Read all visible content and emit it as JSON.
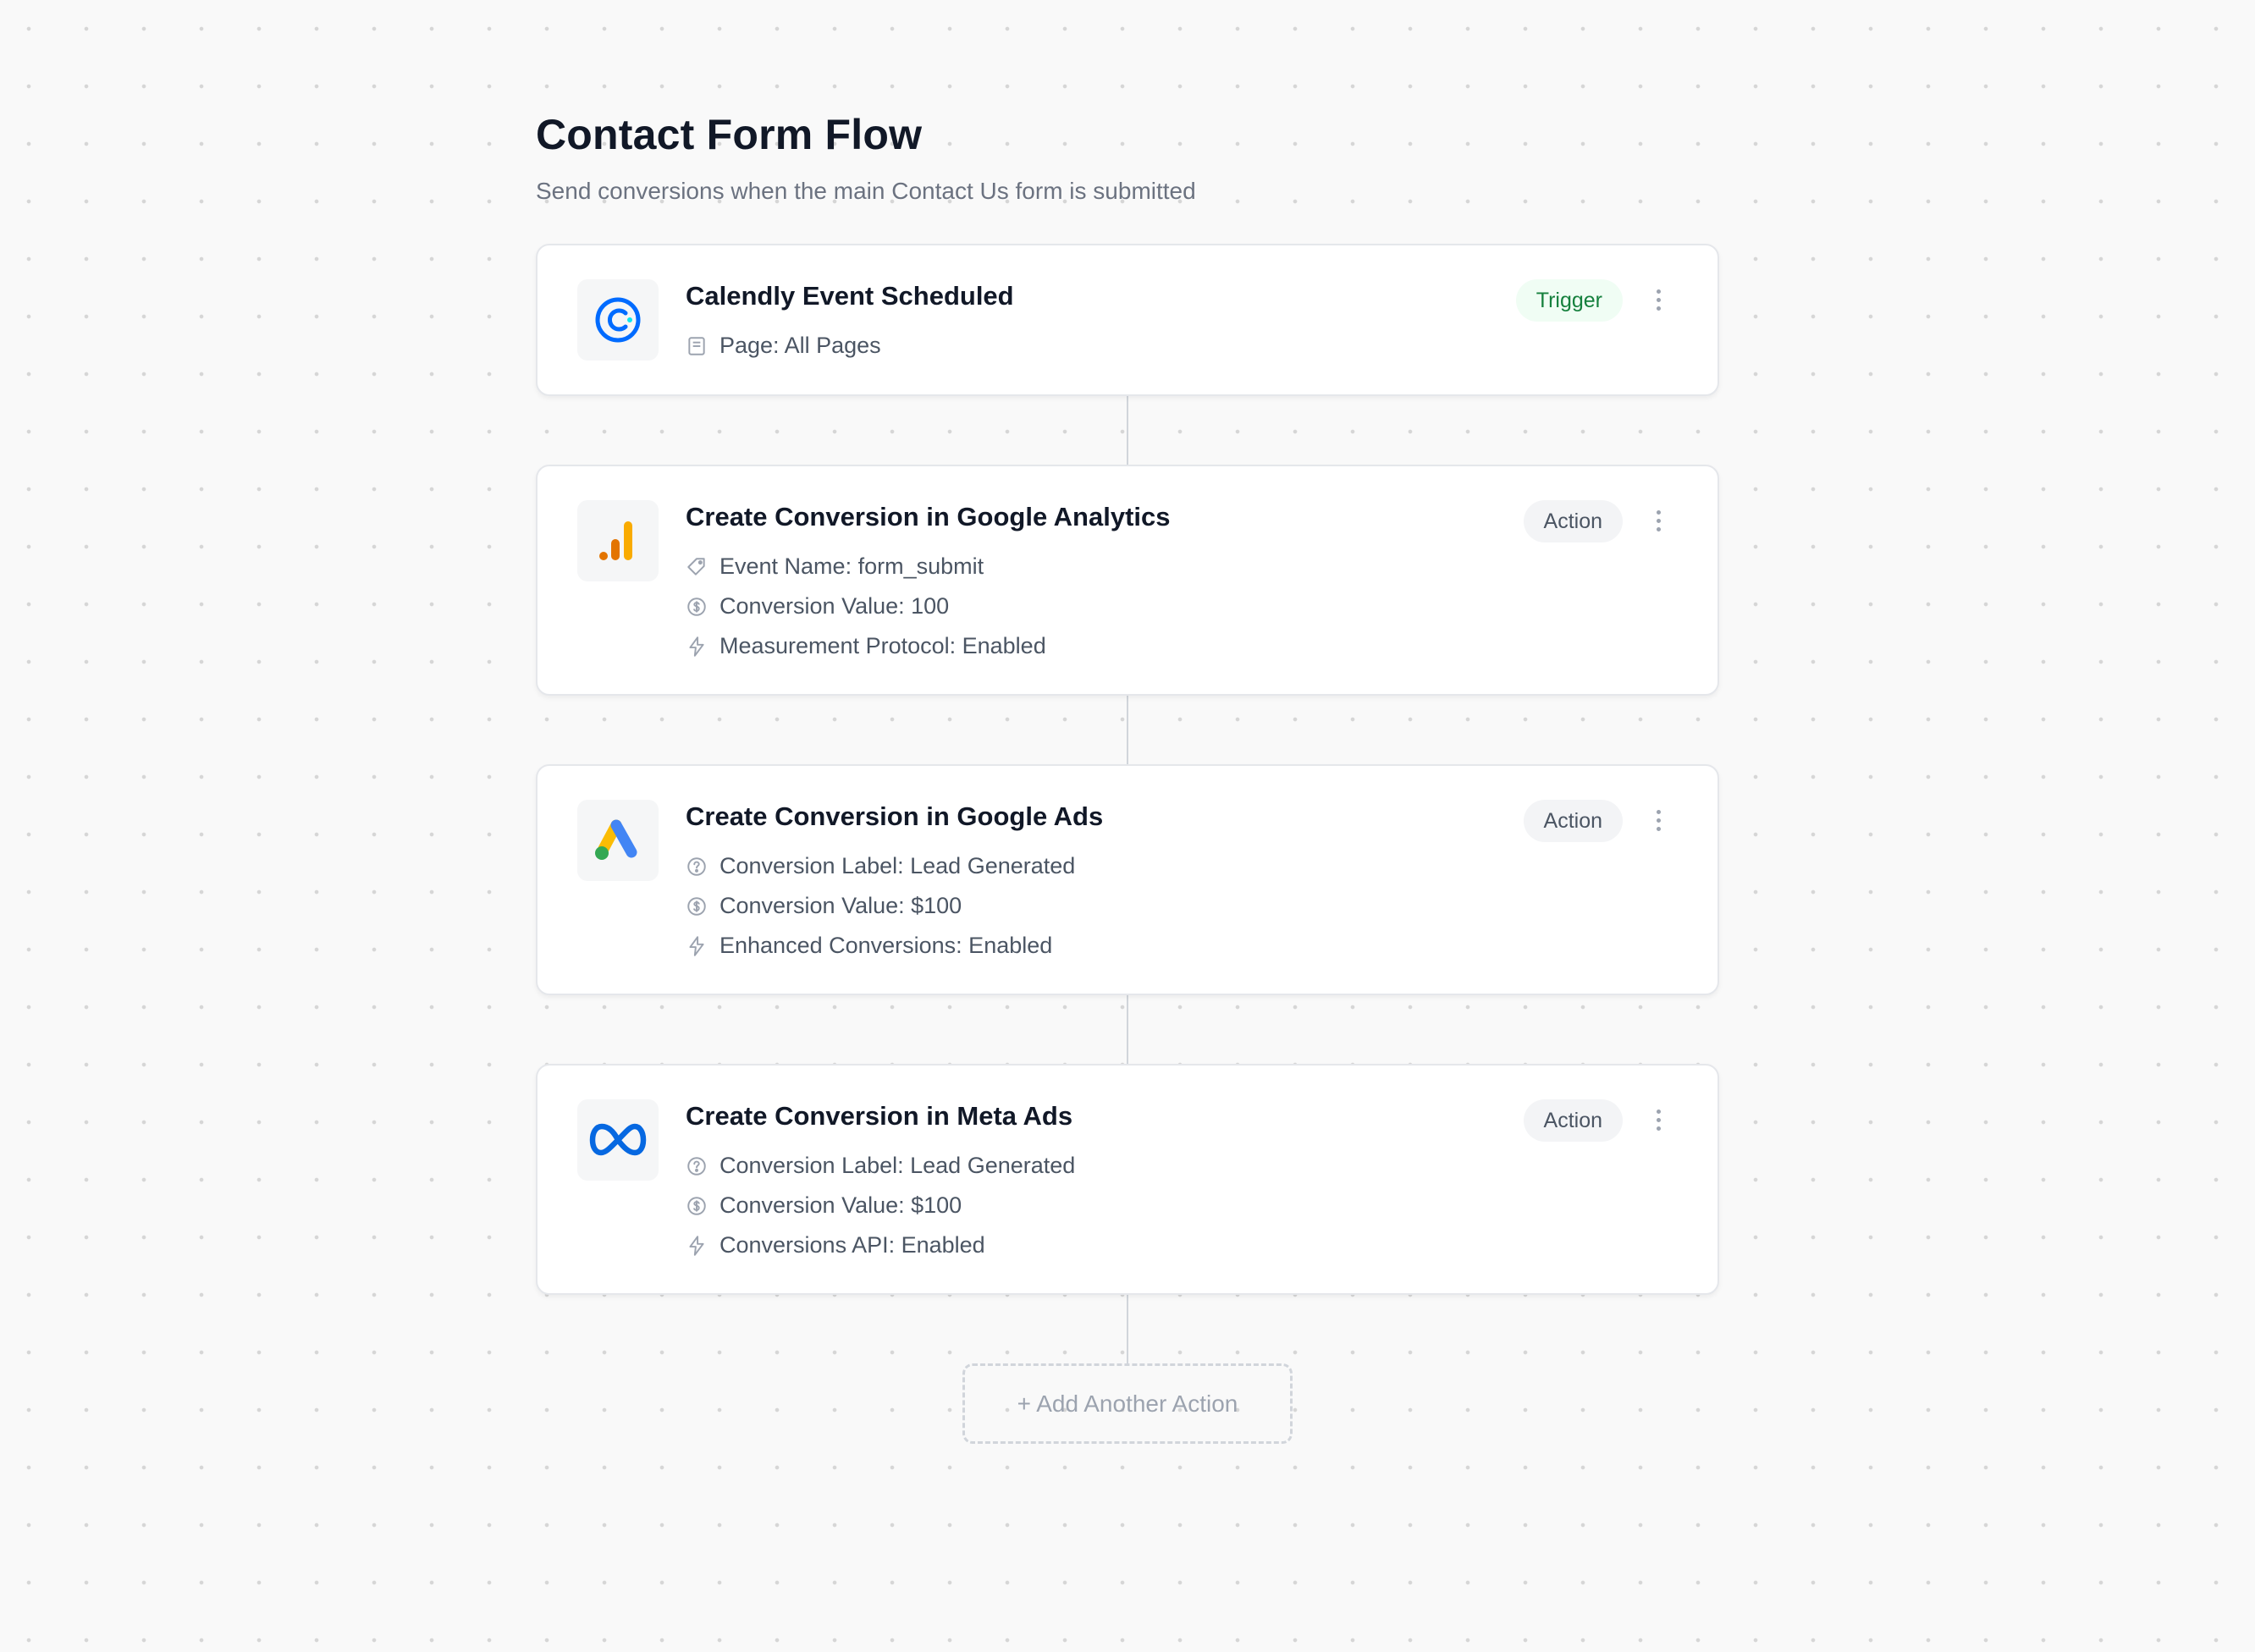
{
  "flow": {
    "title": "Contact Form Flow",
    "subtitle": "Send conversions when the main Contact Us form is submitted"
  },
  "cards": [
    {
      "title": "Calendly Event Scheduled",
      "badge": "Trigger",
      "logo": "calendly-logo",
      "details": [
        {
          "icon": "page-icon",
          "text": "Page: All Pages"
        }
      ]
    },
    {
      "title": "Create Conversion in Google Analytics",
      "badge": "Action",
      "logo": "google-analytics-logo",
      "details": [
        {
          "icon": "tag-icon",
          "text": "Event Name: form_submit"
        },
        {
          "icon": "dollar-circle-icon",
          "text": "Conversion Value: 100"
        },
        {
          "icon": "lightning-icon",
          "text": "Measurement Protocol: Enabled"
        }
      ]
    },
    {
      "title": "Create Conversion in Google Ads",
      "badge": "Action",
      "logo": "google-ads-logo",
      "details": [
        {
          "icon": "help-circle-icon",
          "text": "Conversion Label: Lead Generated"
        },
        {
          "icon": "dollar-circle-icon",
          "text": "Conversion Value: $100"
        },
        {
          "icon": "lightning-icon",
          "text": "Enhanced Conversions: Enabled"
        }
      ]
    },
    {
      "title": "Create Conversion in Meta Ads",
      "badge": "Action",
      "logo": "meta-logo",
      "details": [
        {
          "icon": "help-circle-icon",
          "text": "Conversion Label: Lead Generated"
        },
        {
          "icon": "dollar-circle-icon",
          "text": "Conversion Value: $100"
        },
        {
          "icon": "lightning-icon",
          "text": "Conversions API: Enabled"
        }
      ]
    }
  ],
  "add_action_label": "+ Add Another Action",
  "colors": {
    "trigger_badge_bg": "#f0fdf4",
    "trigger_badge_text": "#15803d",
    "action_badge_bg": "#f3f4f6",
    "calendly_blue": "#006BFF",
    "meta_blue": "#0668E1"
  }
}
